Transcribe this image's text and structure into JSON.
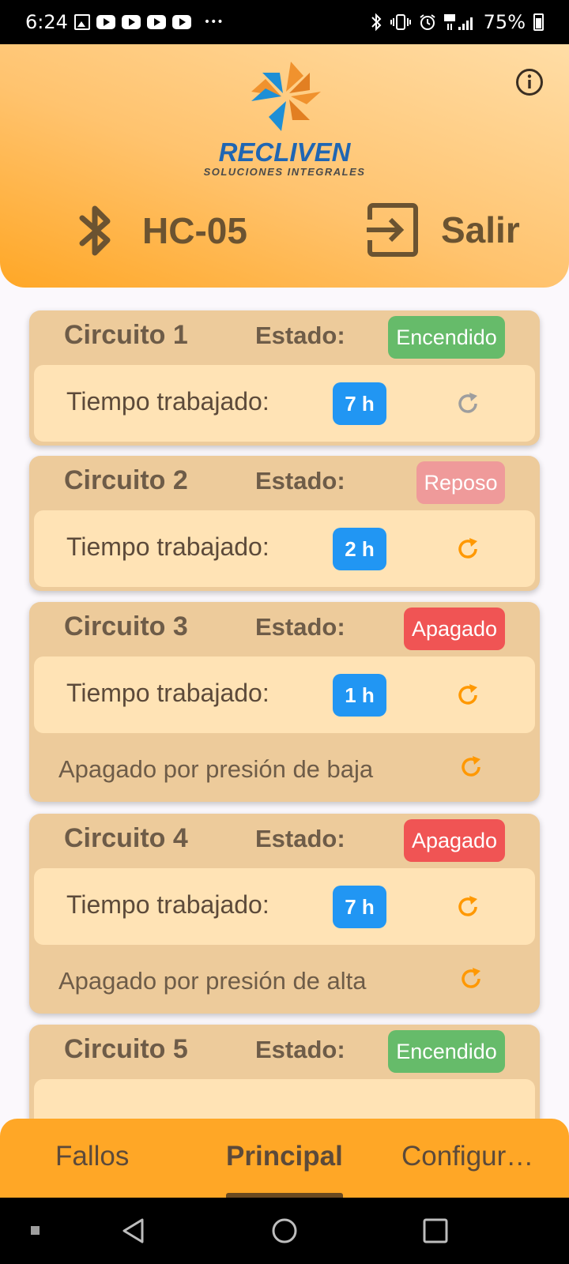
{
  "status_bar": {
    "time": "6:24",
    "battery": "75%",
    "more": "•••"
  },
  "header": {
    "brand_name": "RECLIVEN",
    "brand_tagline": "SOLUCIONES INTEGRALES",
    "device_name": "HC-05",
    "logout_label": "Salir"
  },
  "labels": {
    "estado": "Estado:",
    "tiempo": "Tiempo trabajado:"
  },
  "circuits": [
    {
      "title": "Circuito 1",
      "status": "Encendido",
      "status_color": "#66BB6A",
      "hours": "7 h",
      "refresh_color": "#9E9E9E"
    },
    {
      "title": "Circuito 2",
      "status": "Reposo",
      "status_color": "#EF9A9A",
      "hours": "2 h",
      "refresh_color": "#FF9800"
    },
    {
      "title": "Circuito 3",
      "status": "Apagado",
      "status_color": "#F05454",
      "hours": "1 h",
      "refresh_color": "#FF9800",
      "fault": "Apagado por presión de baja"
    },
    {
      "title": "Circuito 4",
      "status": "Apagado",
      "status_color": "#F05454",
      "hours": "7 h",
      "refresh_color": "#FF9800",
      "fault": "Apagado por presión de alta"
    },
    {
      "title": "Circuito 5",
      "status": "Encendido",
      "status_color": "#66BB6A"
    }
  ],
  "bottom_nav": {
    "tabs": [
      {
        "label": "Fallos"
      },
      {
        "label": "Principal"
      },
      {
        "label": "Configur…"
      }
    ],
    "active_index": 1
  },
  "colors": {
    "accent": "#FFA726",
    "card": "#EDCB9B",
    "card_inner": "#FFE3B5",
    "hours_badge": "#2196F3",
    "text_brown": "#6B5331"
  }
}
